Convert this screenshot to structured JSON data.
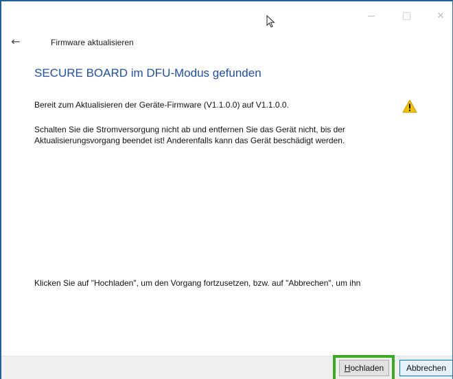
{
  "window": {
    "controls": {
      "minimize_icon": "minimize-icon",
      "maximize_icon": "maximize-icon",
      "close_glyph": "✕"
    }
  },
  "nav": {
    "back_glyph": "←",
    "title": "Firmware aktualisieren"
  },
  "content": {
    "heading": "SECURE BOARD im DFU-Modus gefunden",
    "ready_text": "Bereit zum Aktualisieren der Geräte-Firmware (V1.1.0.0) auf V1.1.0.0.",
    "warning_text": "Schalten Sie die Stromversorgung nicht ab und entfernen Sie das Gerät nicht, bis der Aktualisierungsvorgang beendet ist! Anderenfalls kann das Gerät beschädigt werden.",
    "instruction_text": "Klicken Sie auf \"Hochladen\", um den Vorgang fortzusetzen, bzw. auf \"Abbrechen\", um ihn",
    "warning_icon": "warning-icon"
  },
  "footer": {
    "upload_button_first": "H",
    "upload_button_rest": "ochladen",
    "cancel_button": "Abbrechen"
  },
  "colors": {
    "heading": "#1f4fa6",
    "highlight": "#3cab23",
    "window_border": "#1f5f9e",
    "warning": "#f2c200"
  }
}
